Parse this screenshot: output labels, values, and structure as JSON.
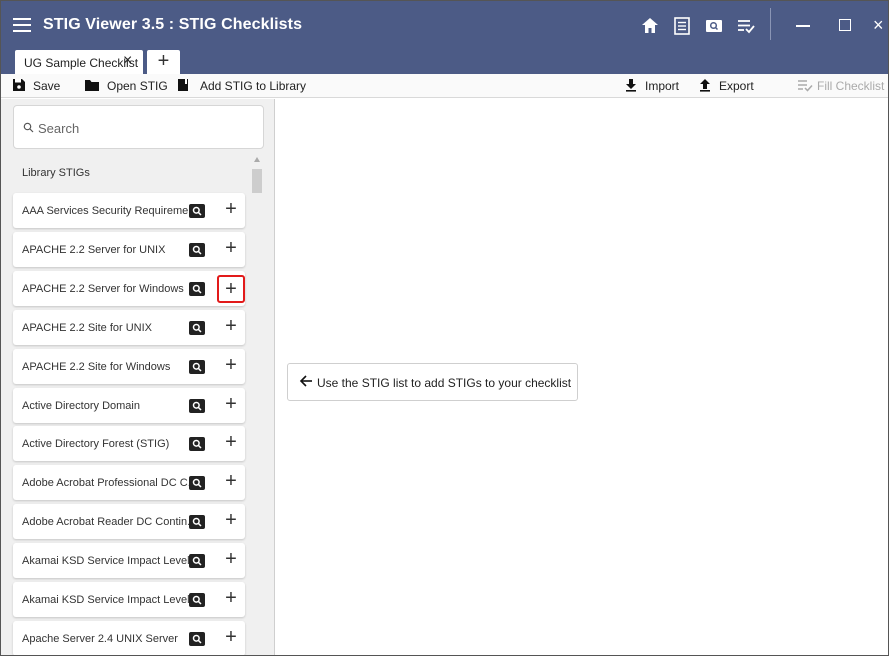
{
  "window": {
    "title": "STIG Viewer 3.5 : STIG Checklists",
    "close_glyph": "×"
  },
  "tabs": {
    "active_label": "UG Sample Checklist",
    "close_glyph": "×",
    "add_glyph": "+"
  },
  "toolbar": {
    "save_label": "Save",
    "open_label": "Open STIG",
    "add_library_label": "Add STIG to Library",
    "import_label": "Import",
    "export_label": "Export",
    "fill_label": "Fill Checklist"
  },
  "sidebar": {
    "search_placeholder": "Search",
    "library_title": "Library STIGs",
    "add_glyph": "+",
    "items": [
      {
        "label": "AAA Services Security Requireme..."
      },
      {
        "label": "APACHE 2.2 Server for UNIX"
      },
      {
        "label": "APACHE 2.2 Server for Windows"
      },
      {
        "label": "APACHE 2.2 Site for UNIX"
      },
      {
        "label": "APACHE 2.2 Site for Windows"
      },
      {
        "label": "Active Directory Domain"
      },
      {
        "label": "Active Directory Forest (STIG)"
      },
      {
        "label": "Adobe Acrobat Professional DC C..."
      },
      {
        "label": "Adobe Acrobat Reader DC Contin..."
      },
      {
        "label": "Akamai KSD Service Impact Level ..."
      },
      {
        "label": "Akamai KSD Service Impact Level ..."
      },
      {
        "label": "Apache Server 2.4 UNIX Server"
      }
    ],
    "highlighted_item": 2
  },
  "main": {
    "hint_text": "Use the STIG list to add STIGs to your checklist"
  },
  "colors": {
    "titlebar": "#4c5b86",
    "highlight": "#e21a1a",
    "disabled_text": "#aaaaaa"
  }
}
